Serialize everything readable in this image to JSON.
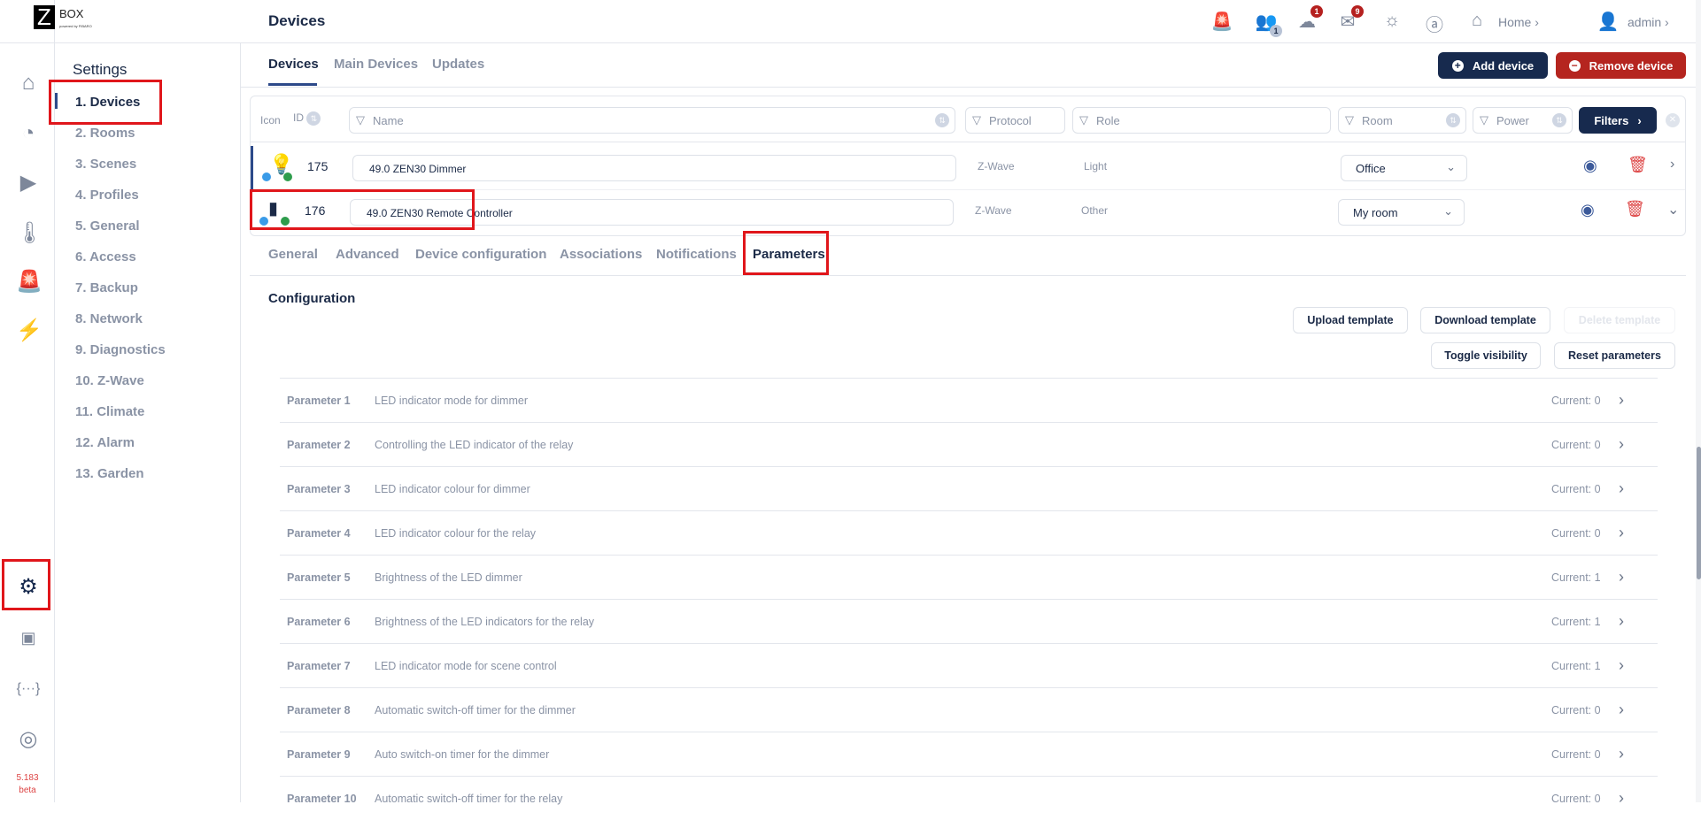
{
  "app": {
    "logo_letter": "Z",
    "logo_text": "BOX",
    "logo_sub": "powered by FIBARO",
    "version": "5.183",
    "version_tag": "beta"
  },
  "rail": [
    "home-icon",
    "scheduler-icon",
    "play-icon",
    "thermometer-icon",
    "alarm-icon",
    "energy-icon",
    "settings-icon",
    "terminal-icon",
    "api-icon",
    "support-icon"
  ],
  "sidebar": {
    "title": "Settings",
    "items": [
      {
        "label": "1.  Devices"
      },
      {
        "label": "2.  Rooms"
      },
      {
        "label": "3.  Scenes"
      },
      {
        "label": "4.  Profiles"
      },
      {
        "label": "5.  General"
      },
      {
        "label": "6.  Access"
      },
      {
        "label": "7.  Backup"
      },
      {
        "label": "8.  Network"
      },
      {
        "label": "9.  Diagnostics"
      },
      {
        "label": "10.  Z-Wave"
      },
      {
        "label": "11.  Climate"
      },
      {
        "label": "12.  Alarm"
      },
      {
        "label": "13.  Garden"
      }
    ]
  },
  "header": {
    "title": "Devices",
    "users_badge": "1",
    "updates_badge": "1",
    "messages_badge": "9",
    "home_label": "Home",
    "user_label": "admin"
  },
  "tabs": [
    {
      "label": "Devices"
    },
    {
      "label": "Main Devices"
    },
    {
      "label": "Updates"
    }
  ],
  "actions": {
    "add": "Add device",
    "remove": "Remove device",
    "add_color": "#172a4e",
    "remove_color": "#b5251f"
  },
  "filters": {
    "icon": "Icon",
    "id": "ID",
    "name": "Name",
    "protocol": "Protocol",
    "role": "Role",
    "room": "Room",
    "power": "Power",
    "button": "Filters"
  },
  "devices": [
    {
      "id": "175",
      "name": "49.0 ZEN30 Dimmer",
      "protocol": "Z-Wave",
      "role": "Light",
      "room": "Office",
      "icon": "bulb-icon"
    },
    {
      "id": "176",
      "name": "49.0 ZEN30 Remote Controller",
      "protocol": "Z-Wave",
      "role": "Other",
      "room": "My room",
      "icon": "remote-icon"
    }
  ],
  "subtabs": [
    {
      "label": "General"
    },
    {
      "label": "Advanced"
    },
    {
      "label": "Device configuration"
    },
    {
      "label": "Associations"
    },
    {
      "label": "Notifications"
    },
    {
      "label": "Parameters"
    }
  ],
  "config": {
    "title": "Configuration",
    "upload": "Upload template",
    "download": "Download template",
    "delete": "Delete template",
    "toggle": "Toggle visibility",
    "reset": "Reset parameters"
  },
  "parameters": [
    {
      "name": "Parameter 1",
      "desc": "LED indicator mode for dimmer",
      "current": "Current: 0"
    },
    {
      "name": "Parameter 2",
      "desc": "Controlling the LED indicator of the relay",
      "current": "Current: 0"
    },
    {
      "name": "Parameter 3",
      "desc": "LED indicator colour for dimmer",
      "current": "Current: 0"
    },
    {
      "name": "Parameter 4",
      "desc": "LED indicator colour for the relay",
      "current": "Current: 0"
    },
    {
      "name": "Parameter 5",
      "desc": "Brightness of the LED dimmer",
      "current": "Current: 1"
    },
    {
      "name": "Parameter 6",
      "desc": "Brightness of the LED indicators for the relay",
      "current": "Current: 1"
    },
    {
      "name": "Parameter 7",
      "desc": "LED indicator mode for scene control",
      "current": "Current: 1"
    },
    {
      "name": "Parameter 8",
      "desc": "Automatic switch-off timer for the dimmer",
      "current": "Current: 0"
    },
    {
      "name": "Parameter 9",
      "desc": "Auto switch-on timer for the dimmer",
      "current": "Current: 0"
    },
    {
      "name": "Parameter 10",
      "desc": "Automatic switch-off timer for the relay",
      "current": "Current: 0"
    }
  ]
}
